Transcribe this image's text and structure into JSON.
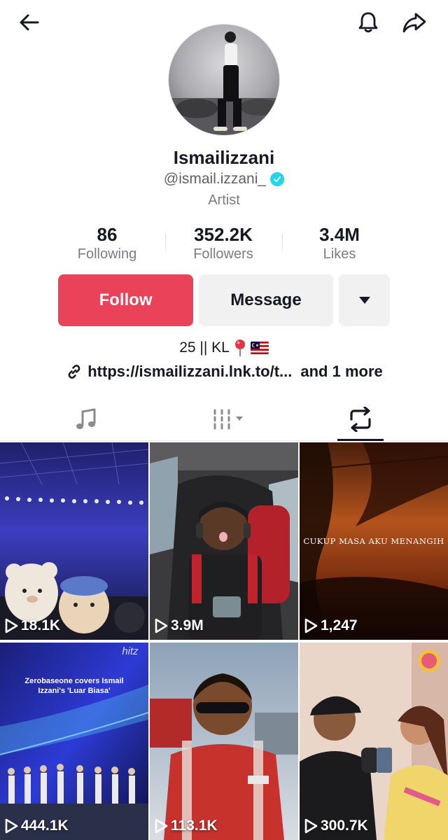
{
  "profile": {
    "display_name": "Ismailizzani",
    "handle": "@ismail.izzani_",
    "category": "Artist",
    "bio_line": "25 || KL",
    "link_text": "https://ismailizzani.lnk.to/t...",
    "link_more": "and 1 more",
    "verified": true
  },
  "stats": [
    {
      "value": "86",
      "label": "Following"
    },
    {
      "value": "352.2K",
      "label": "Followers"
    },
    {
      "value": "3.4M",
      "label": "Likes"
    }
  ],
  "actions": {
    "follow_label": "Follow",
    "message_label": "Message"
  },
  "tabs": [
    {
      "icon": "music-note-icon"
    },
    {
      "icon": "playlist-grid-icon"
    },
    {
      "icon": "repost-icon",
      "active": true
    }
  ],
  "videos": [
    {
      "views": "18.1K",
      "overlay": ""
    },
    {
      "views": "3.9M",
      "overlay": ""
    },
    {
      "views": "1,247",
      "overlay": "CUKUP MASA AKU MENANGIH"
    },
    {
      "views": "444.1K",
      "overlay": "Zerobaseone covers Ismail Izzani's 'Luar Biasa'",
      "badge": "hitz"
    },
    {
      "views": "113.1K",
      "overlay": ""
    },
    {
      "views": "300.7K",
      "overlay": ""
    }
  ],
  "colors": {
    "accent": "#ea4359",
    "text": "#161823",
    "muted": "#7a7c82",
    "button_bg": "#f1f1f2",
    "verified": "#20d5ec"
  }
}
